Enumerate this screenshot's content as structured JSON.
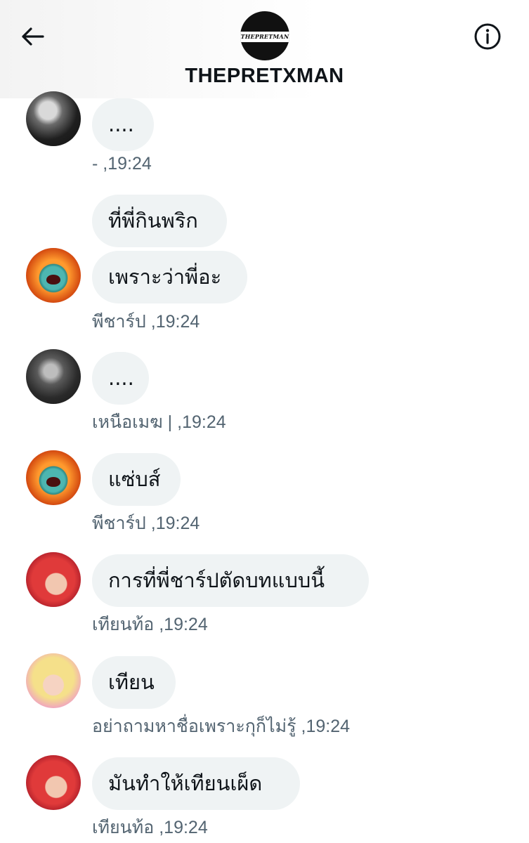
{
  "header": {
    "group_name": "THEPRETXMAN",
    "logo_text": "THEPRETMAN",
    "back_icon": "arrow-left-icon",
    "info_icon": "info-icon"
  },
  "colors": {
    "bubble_bg": "#eff3f4",
    "meta_text": "#536471",
    "primary_text": "#0f1419"
  },
  "messages": [
    {
      "avatar": "dark-photo-avatar",
      "bubbles": [
        "...."
      ],
      "sender": "-",
      "time": "19:24"
    },
    {
      "avatar": "orange-monster-avatar",
      "bubbles": [
        "ที่พี่กินพริก",
        "เพราะว่าพี่อะ"
      ],
      "sender": "พีชาร์ป",
      "time": "19:24"
    },
    {
      "avatar": "dark-photo-avatar",
      "bubbles": [
        "...."
      ],
      "sender": "เหนือเมฆ |",
      "time": "19:24"
    },
    {
      "avatar": "orange-monster-avatar",
      "bubbles": [
        "แซ่บส์"
      ],
      "sender": "พีชาร์ป",
      "time": "19:24"
    },
    {
      "avatar": "red-hair-princess-avatar",
      "bubbles": [
        "การที่พี่ชาร์ปตัดบทแบบนี้"
      ],
      "sender": "เทียนท้อ",
      "time": "19:24"
    },
    {
      "avatar": "blonde-doll-avatar",
      "bubbles": [
        "เทียน"
      ],
      "sender": "อย่าถามหาชื่อเพราะกุก็ไม่รู้",
      "time": "19:24"
    },
    {
      "avatar": "red-hair-princess-avatar",
      "bubbles": [
        "มันทำให้เทียนเผ็ด"
      ],
      "sender": "เทียนท้อ",
      "time": "19:24"
    }
  ]
}
